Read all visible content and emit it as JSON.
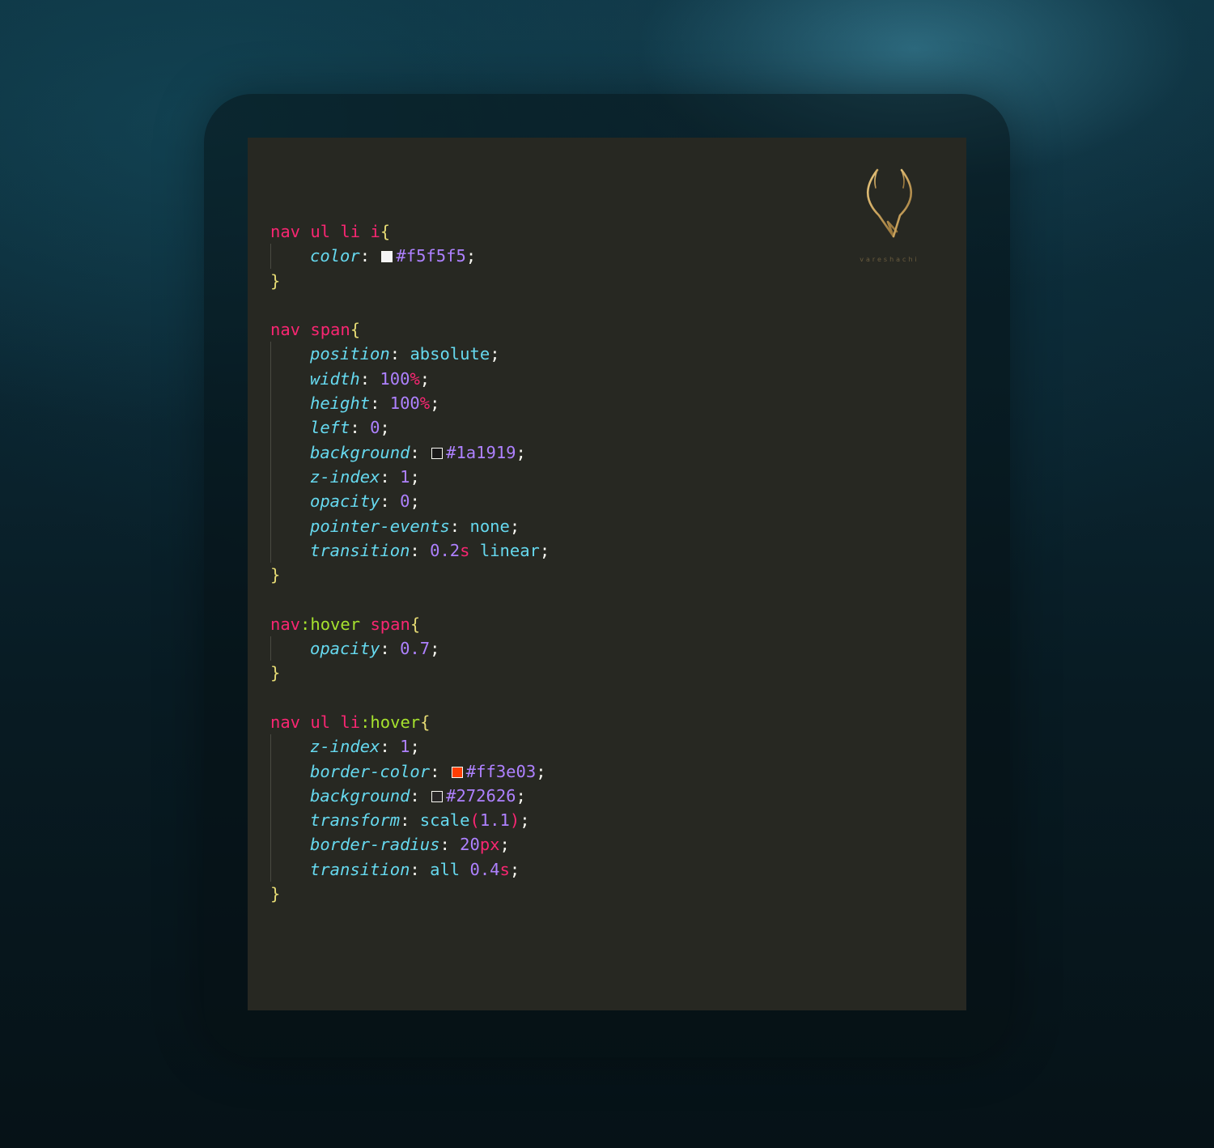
{
  "logo": {
    "icon": "antler-v-logo-icon",
    "wordmark": "vareshachi",
    "color": "#c9a25c"
  },
  "colors": {
    "editor_bg": "#272822",
    "selector": "#f92672",
    "pseudo": "#a6e22e",
    "brace": "#e6db74",
    "property": "#66d9ef",
    "number": "#ae81ff"
  },
  "rules": [
    {
      "sel": [
        {
          "t": "nav",
          "c": "sel"
        },
        {
          "t": " ",
          "c": "punct"
        },
        {
          "t": "ul",
          "c": "sel"
        },
        {
          "t": " ",
          "c": "punct"
        },
        {
          "t": "li",
          "c": "sel"
        },
        {
          "t": " ",
          "c": "punct"
        },
        {
          "t": "i",
          "c": "sel"
        }
      ],
      "decls": [
        {
          "prop": "color",
          "val": [
            {
              "swatch": "#f5f5f5"
            },
            {
              "t": "#f5f5f5",
              "c": "hex"
            }
          ]
        }
      ]
    },
    {
      "sel": [
        {
          "t": "nav",
          "c": "sel"
        },
        {
          "t": " ",
          "c": "punct"
        },
        {
          "t": "span",
          "c": "sel"
        }
      ],
      "decls": [
        {
          "prop": "position",
          "val": [
            {
              "t": "absolute",
              "c": "kw"
            }
          ]
        },
        {
          "prop": "width",
          "val": [
            {
              "t": "100",
              "c": "num"
            },
            {
              "t": "%",
              "c": "unit"
            }
          ]
        },
        {
          "prop": "height",
          "val": [
            {
              "t": "100",
              "c": "num"
            },
            {
              "t": "%",
              "c": "unit"
            }
          ]
        },
        {
          "prop": "left",
          "val": [
            {
              "t": "0",
              "c": "num"
            }
          ]
        },
        {
          "prop": "background",
          "val": [
            {
              "swatch": "#1a1919"
            },
            {
              "t": "#1a1919",
              "c": "hex"
            }
          ]
        },
        {
          "prop": "z-index",
          "val": [
            {
              "t": "1",
              "c": "num"
            }
          ]
        },
        {
          "prop": "opacity",
          "val": [
            {
              "t": "0",
              "c": "num"
            }
          ]
        },
        {
          "prop": "pointer-events",
          "val": [
            {
              "t": "none",
              "c": "kw"
            }
          ]
        },
        {
          "prop": "transition",
          "val": [
            {
              "t": "0.2",
              "c": "num"
            },
            {
              "t": "s",
              "c": "unit"
            },
            {
              "t": " ",
              "c": "punct"
            },
            {
              "t": "linear",
              "c": "kw"
            }
          ]
        }
      ]
    },
    {
      "sel": [
        {
          "t": "nav",
          "c": "sel"
        },
        {
          "t": ":hover",
          "c": "pseudo"
        },
        {
          "t": " ",
          "c": "punct"
        },
        {
          "t": "span",
          "c": "sel"
        }
      ],
      "decls": [
        {
          "prop": "opacity",
          "val": [
            {
              "t": "0.7",
              "c": "num"
            }
          ]
        }
      ]
    },
    {
      "sel": [
        {
          "t": "nav",
          "c": "sel"
        },
        {
          "t": " ",
          "c": "punct"
        },
        {
          "t": "ul",
          "c": "sel"
        },
        {
          "t": " ",
          "c": "punct"
        },
        {
          "t": "li",
          "c": "sel"
        },
        {
          "t": ":hover",
          "c": "pseudo"
        }
      ],
      "decls": [
        {
          "prop": "z-index",
          "val": [
            {
              "t": "1",
              "c": "num"
            }
          ]
        },
        {
          "prop": "border-color",
          "val": [
            {
              "swatch": "#ff3e03"
            },
            {
              "t": "#ff3e03",
              "c": "hex"
            }
          ]
        },
        {
          "prop": "background",
          "val": [
            {
              "swatch": "#272626"
            },
            {
              "t": "#272626",
              "c": "hex"
            }
          ]
        },
        {
          "prop": "transform",
          "val": [
            {
              "t": "scale",
              "c": "kw"
            },
            {
              "t": "(",
              "c": "unit"
            },
            {
              "t": "1.1",
              "c": "num"
            },
            {
              "t": ")",
              "c": "unit"
            }
          ]
        },
        {
          "prop": "border-radius",
          "val": [
            {
              "t": "20",
              "c": "num"
            },
            {
              "t": "px",
              "c": "unit"
            }
          ]
        },
        {
          "prop": "transition",
          "val": [
            {
              "t": "all",
              "c": "kw"
            },
            {
              "t": " ",
              "c": "punct"
            },
            {
              "t": "0.4",
              "c": "num"
            },
            {
              "t": "s",
              "c": "unit"
            }
          ]
        }
      ]
    }
  ]
}
